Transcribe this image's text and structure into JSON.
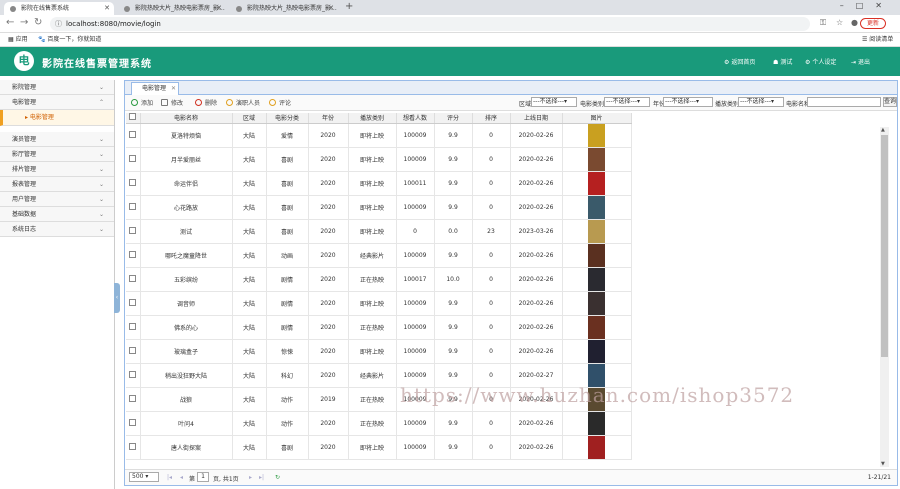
{
  "browser": {
    "tabs": [
      {
        "title": "影院在线售票系统"
      },
      {
        "title": "影院热映大片_热映电影票房_影..."
      },
      {
        "title": "影院热映大片_热映电影票房_影..."
      }
    ],
    "url": "localhost:8080/movie/login",
    "update_label": "更新",
    "bookmarks": {
      "apps": "应用",
      "baidu": "百度一下，你就知道",
      "reading_list": "阅读清单"
    }
  },
  "app": {
    "title": "影院在线售票管理系统",
    "logo_char": "电",
    "header_links": {
      "home": "返回首页",
      "user": "测试",
      "settings": "个人设定",
      "logout": "退出"
    },
    "accent_color": "#199a7b"
  },
  "sidebar": {
    "items": [
      {
        "label": "影院管理"
      },
      {
        "label": "电影管理"
      },
      {
        "label": "演员管理"
      },
      {
        "label": "影厅管理"
      },
      {
        "label": "排片管理"
      },
      {
        "label": "报表管理"
      },
      {
        "label": "用户管理"
      },
      {
        "label": "基础数据"
      },
      {
        "label": "系统日志"
      }
    ],
    "active_sub": "电影管理"
  },
  "panel": {
    "tab_label": "电影管理",
    "toolbar": {
      "add": "添加",
      "edit": "修改",
      "delete": "删除",
      "actors": "演职人员",
      "review": "评论"
    },
    "filters": {
      "region_label": "区域",
      "type_label": "电影类别",
      "year_label": "年份",
      "status_label": "播放类别",
      "name_label": "电影名称",
      "select_placeholder": "---不选择---",
      "search": "查询"
    }
  },
  "table": {
    "columns": [
      "电影名称",
      "区域",
      "电影分类",
      "年份",
      "播放类别",
      "想看人数",
      "评分",
      "排序",
      "上线日期",
      "图片"
    ],
    "rows": [
      [
        "夏洛特烦恼",
        "大陆",
        "爱情",
        "2020",
        "即将上映",
        "100009",
        "9.9",
        "0",
        "2020-02-26"
      ],
      [
        "月半爱丽丝",
        "大陆",
        "喜剧",
        "2020",
        "即将上映",
        "100009",
        "9.9",
        "0",
        "2020-02-26"
      ],
      [
        "命运伴侣",
        "大陆",
        "喜剧",
        "2020",
        "即将上映",
        "100011",
        "9.9",
        "0",
        "2020-02-26"
      ],
      [
        "心花路放",
        "大陆",
        "喜剧",
        "2020",
        "即将上映",
        "100009",
        "9.9",
        "0",
        "2020-02-26"
      ],
      [
        "测试",
        "大陆",
        "喜剧",
        "2020",
        "即将上映",
        "0",
        "0.0",
        "23",
        "2023-03-26"
      ],
      [
        "哪吒之魔童降世",
        "大陆",
        "动画",
        "2020",
        "经典影片",
        "100009",
        "9.9",
        "0",
        "2020-02-26"
      ],
      [
        "五彩缤纷",
        "大陆",
        "剧情",
        "2020",
        "正在热映",
        "100017",
        "10.0",
        "0",
        "2020-02-26"
      ],
      [
        "调音师",
        "大陆",
        "剧情",
        "2020",
        "即将上映",
        "100009",
        "9.9",
        "0",
        "2020-02-26"
      ],
      [
        "佛系的心",
        "大陆",
        "剧情",
        "2020",
        "正在热映",
        "100009",
        "9.9",
        "0",
        "2020-02-26"
      ],
      [
        "玻璃盒子",
        "大陆",
        "惊悚",
        "2020",
        "即将上映",
        "100009",
        "9.9",
        "0",
        "2020-02-26"
      ],
      [
        "稍出没狂野大陆",
        "大陆",
        "科幻",
        "2020",
        "经典影片",
        "100009",
        "9.9",
        "0",
        "2020-02-27"
      ],
      [
        "战狼",
        "大陆",
        "动作",
        "2019",
        "正在热映",
        "100009",
        "9.9",
        "0",
        "2020-02-26"
      ],
      [
        "叶问4",
        "大陆",
        "动作",
        "2020",
        "正在热映",
        "100009",
        "9.9",
        "0",
        "2020-02-26"
      ],
      [
        "唐人街探案",
        "大陆",
        "喜剧",
        "2020",
        "即将上映",
        "100009",
        "9.9",
        "0",
        "2020-02-26"
      ]
    ],
    "thumb_colors": [
      "#c9a020",
      "#7a4a30",
      "#b52020",
      "#3a5a6a",
      "#b89a50",
      "#5a3020",
      "#2a2a30",
      "#3a3030",
      "#6a3020",
      "#202030",
      "#30506a",
      "#5a4a30",
      "#2a2a2a",
      "#a02020"
    ]
  },
  "pager": {
    "page_size": "500",
    "page_prefix": "第",
    "page_value": "1",
    "page_suffix": "页, 共1页",
    "range": "1-21/21"
  },
  "watermark": "https://www.huzhan.com/ishop3572"
}
